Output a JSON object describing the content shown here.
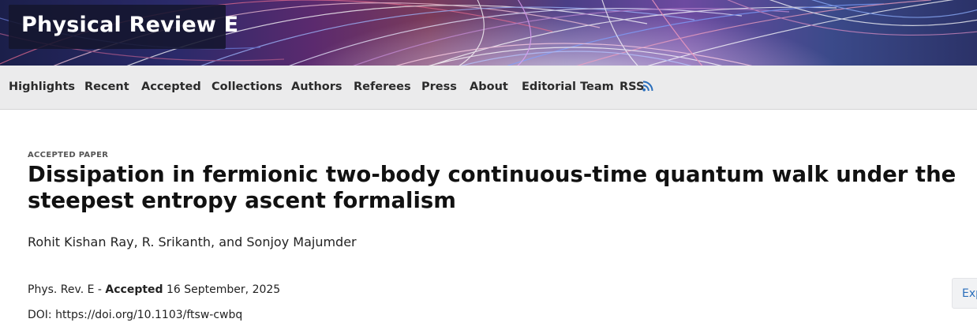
{
  "header": {
    "journal_title": "Physical Review E"
  },
  "nav": {
    "items": [
      {
        "label": "Highlights"
      },
      {
        "label": "Recent"
      },
      {
        "label": "Accepted"
      },
      {
        "label": "Collections"
      },
      {
        "label": "Authors"
      },
      {
        "label": "Referees"
      },
      {
        "label": "Press"
      },
      {
        "label": "About"
      },
      {
        "label": "Editorial Team"
      },
      {
        "label": "RSS"
      }
    ],
    "rss_icon": "rss-feed-icon"
  },
  "article": {
    "kicker": "ACCEPTED PAPER",
    "title": "Dissipation in fermionic two-body continuous-time quantum walk under the steepest entropy ascent formalism",
    "authors": "Rohit Kishan Ray, R. Srikanth, and Sonjoy Majumder",
    "journal_prefix": "Phys. Rev. E - ",
    "status_label": "Accepted",
    "date": " 16 September, 2025",
    "doi_prefix": "DOI: ",
    "doi_url": "https://doi.org/10.1103/ftsw-cwbq"
  },
  "actions": {
    "export_label": "Exp"
  },
  "colors": {
    "nav_background": "#ebebec",
    "link_blue": "#2a6ebb",
    "title_box": "#14162d"
  }
}
